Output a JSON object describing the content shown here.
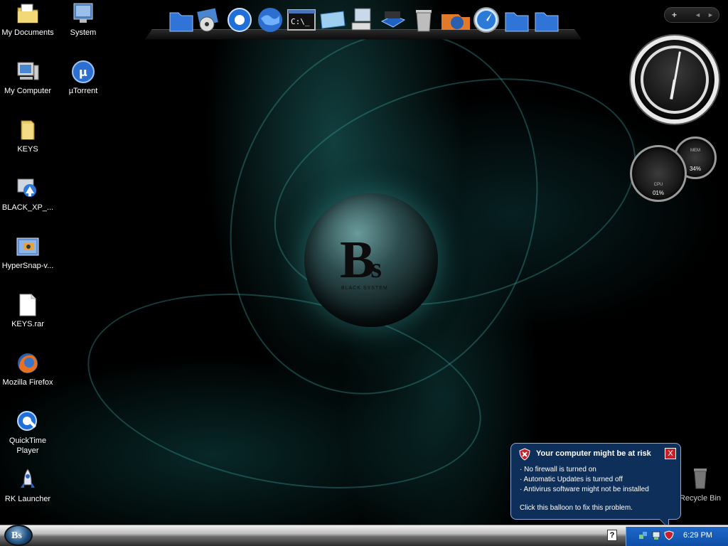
{
  "desktop_icons": [
    {
      "label": "My Documents",
      "icon": "folder-documents-icon"
    },
    {
      "label": "System",
      "icon": "system-icon"
    },
    {
      "label": "My Computer",
      "icon": "computer-icon"
    },
    {
      "label": "µTorrent",
      "icon": "utorrent-icon"
    },
    {
      "label": "KEYS",
      "icon": "folder-icon"
    },
    {
      "label": "BLACK_XP_...",
      "icon": "xp-installer-icon"
    },
    {
      "label": "HyperSnap-v...",
      "icon": "hypersnap-icon"
    },
    {
      "label": "KEYS.rar",
      "icon": "file-icon"
    },
    {
      "label": "Mozilla Firefox",
      "icon": "firefox-icon"
    },
    {
      "label": "QuickTime Player",
      "icon": "quicktime-icon"
    },
    {
      "label": "RK Launcher",
      "icon": "rocket-icon"
    }
  ],
  "dock": {
    "items": [
      "folder-icon",
      "media-player-icon",
      "quicktime-icon",
      "globe-icon",
      "command-prompt-icon",
      "window-icon",
      "computer-icon",
      "drive-icon",
      "trash-icon",
      "firefox-icon",
      "safari-icon",
      "folder-icon",
      "folder-icon"
    ],
    "cmd_text": "C:\\_"
  },
  "sidebar": {
    "add_label": "+",
    "prev_label": "◄",
    "next_label": "►"
  },
  "cpu_meter": {
    "cpu": "01%",
    "ram": "34%",
    "cpu_label": "CPU",
    "ram_label": "MEM"
  },
  "orb": {
    "letters": "B",
    "letters_small": "s",
    "subtitle": "BLACK SYSTEM"
  },
  "recycle_bin": {
    "label": "Recycle Bin"
  },
  "balloon": {
    "title": "Your computer might be at risk",
    "lines": [
      "· No firewall is turned on",
      "· Automatic Updates is turned off",
      "· Antivirus software might not be installed"
    ],
    "footer": "Click this balloon to fix this problem.",
    "close_label": "X",
    "icon": "security-shield-icon"
  },
  "taskbar": {
    "start_label": "Bs",
    "help_label": "?",
    "clock": "6:29 PM",
    "tray_icons": [
      "network-icon",
      "network-icon",
      "security-shield-icon"
    ]
  },
  "colors": {
    "balloon_bg": "#0e2f5a",
    "tray_bg": "#1e68c9",
    "accent_teal": "#3aa9a5"
  }
}
